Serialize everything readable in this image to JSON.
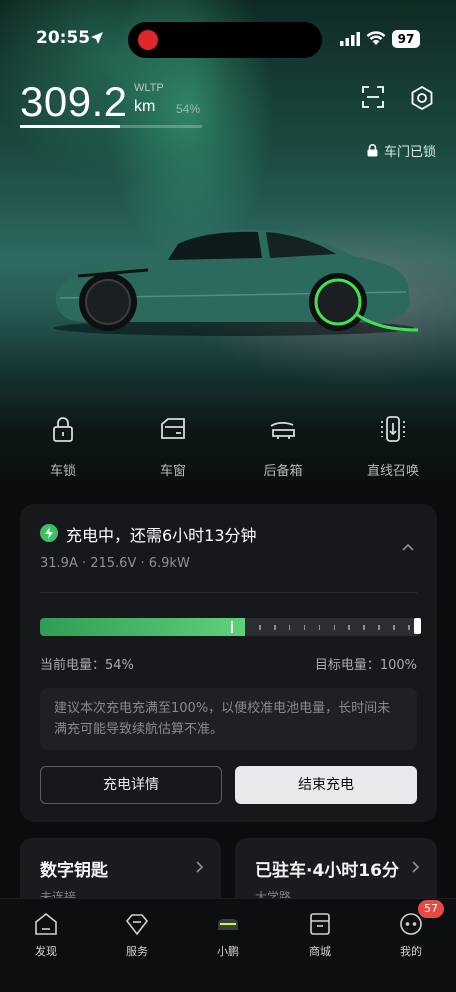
{
  "status_bar": {
    "time": "20:55",
    "battery": "97"
  },
  "range": {
    "value": "309.2",
    "standard": "WLTP",
    "unit": "km",
    "battery_percent": "54%",
    "progress": 0.54
  },
  "lock_status": "车门已锁",
  "quick_actions": [
    {
      "label": "车锁",
      "icon": "lock-icon"
    },
    {
      "label": "车窗",
      "icon": "window-icon"
    },
    {
      "label": "后备箱",
      "icon": "trunk-icon"
    },
    {
      "label": "直线召唤",
      "icon": "summon-icon"
    }
  ],
  "charging": {
    "title": "充电中，还需6小时13分钟",
    "stats": "31.9A · 215.6V · 6.9kW",
    "current_level": 0.54,
    "target_level": 1.0,
    "current_label": "当前电量：",
    "current_value": "54%",
    "target_label": "目标电量：",
    "target_value": "100%",
    "advice": "建议本次充电充满至100%，以便校准电池电量，长时间未满充可能导致续航估算不准。",
    "detail_button": "充电详情",
    "end_button": "结束充电",
    "accent": "#3fbf62"
  },
  "cards": [
    {
      "title": "数字钥匙",
      "subtitle": "未连接"
    },
    {
      "title": "已驻车·4小时16分",
      "subtitle": "大学路"
    }
  ],
  "nav": {
    "items": [
      {
        "label": "发现",
        "icon": "home-icon"
      },
      {
        "label": "服务",
        "icon": "diamond-icon"
      },
      {
        "label": "小鹏",
        "icon": "car-icon"
      },
      {
        "label": "商城",
        "icon": "shopping-bag-icon"
      },
      {
        "label": "我的",
        "icon": "profile-icon"
      }
    ],
    "badge": "57"
  }
}
